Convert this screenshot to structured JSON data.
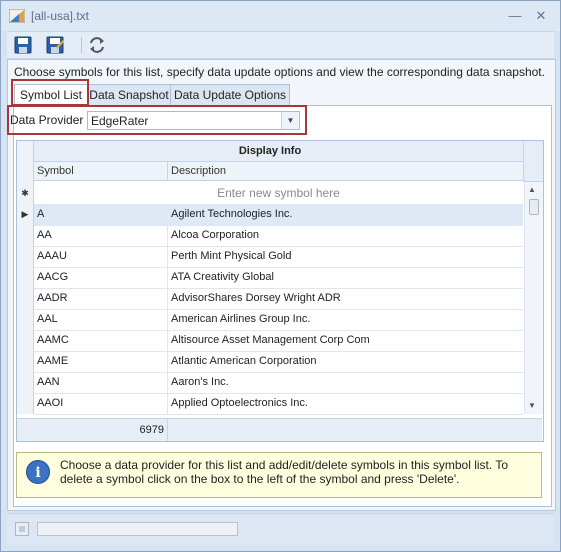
{
  "window": {
    "title": "[all-usa].txt",
    "minimize_icon": "minimize-icon",
    "close_icon": "close-icon"
  },
  "toolbar": {
    "buttons": [
      {
        "icon": "save-icon"
      },
      {
        "icon": "save-as-icon"
      },
      {
        "icon": "refresh-icon"
      }
    ]
  },
  "description": "Choose symbols for this list, specify data update options and view the corresponding data snapshot.",
  "tabs": [
    {
      "label": "Symbol List",
      "active": true
    },
    {
      "label": "Data Snapshot",
      "active": false
    },
    {
      "label": "Data Update Options",
      "active": false
    }
  ],
  "data_provider": {
    "label": "Data Provider",
    "value": "EdgeRater"
  },
  "grid": {
    "band_title": "Display Info",
    "columns": [
      "Symbol",
      "Description"
    ],
    "new_row_placeholder": "Enter new symbol here",
    "rows": [
      {
        "symbol": "A",
        "description": "Agilent Technologies Inc.",
        "selected": true
      },
      {
        "symbol": "AA",
        "description": "Alcoa Corporation"
      },
      {
        "symbol": "AAAU",
        "description": "Perth Mint Physical Gold"
      },
      {
        "symbol": "AACG",
        "description": "ATA Creativity Global"
      },
      {
        "symbol": "AADR",
        "description": "AdvisorShares Dorsey Wright ADR"
      },
      {
        "symbol": "AAL",
        "description": "American Airlines Group Inc."
      },
      {
        "symbol": "AAMC",
        "description": "Altisource Asset Management Corp Com"
      },
      {
        "symbol": "AAME",
        "description": "Atlantic American Corporation"
      },
      {
        "symbol": "AAN",
        "description": "Aaron's Inc."
      },
      {
        "symbol": "AAOI",
        "description": "Applied Optoelectronics Inc."
      }
    ],
    "footer_count": "6979"
  },
  "info": {
    "text": "Choose a data provider for this list and add/edit/delete symbols in this symbol list. To delete a symbol click on the box to the left of the symbol and press 'Delete'."
  },
  "colors": {
    "highlight_border": "#a83838",
    "info_background": "#ffffe0",
    "selected_row": "#dfe9f6"
  }
}
